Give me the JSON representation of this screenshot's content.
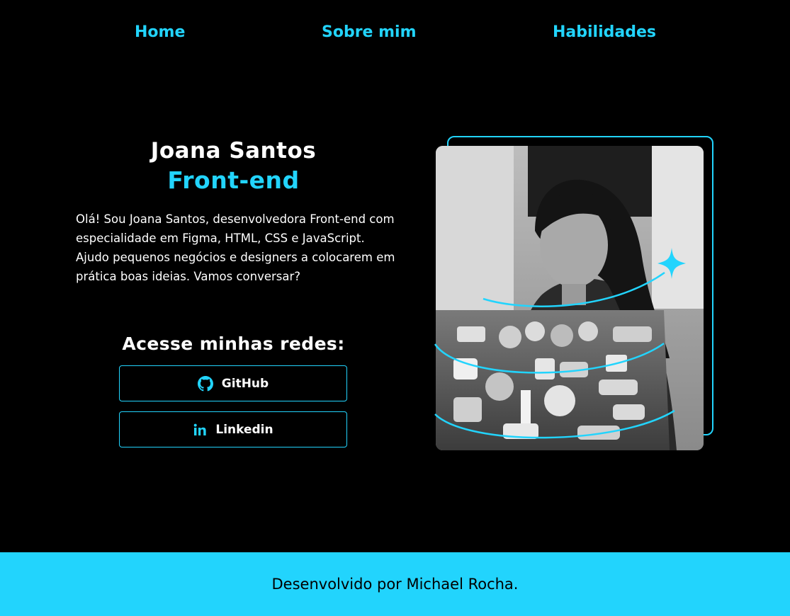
{
  "nav": {
    "items": [
      {
        "label": "Home"
      },
      {
        "label": "Sobre mim"
      },
      {
        "label": "Habilidades"
      }
    ]
  },
  "hero": {
    "name": "Joana Santos",
    "role": "Front-end",
    "bio": "Olá! Sou Joana Santos, desenvolvedora Front-end com especialidade em Figma, HTML, CSS e JavaScript. Ajudo pequenos negócios e designers a colocarem em prática boas ideias. Vamos conversar?",
    "social_title": "Acesse minhas redes:",
    "social": [
      {
        "label": "GitHub",
        "icon": "github-icon"
      },
      {
        "label": "Linkedin",
        "icon": "linkedin-icon"
      }
    ],
    "photo_alt": "Foto de Joana Santos"
  },
  "footer": {
    "text": "Desenvolvido por Michael Rocha."
  },
  "colors": {
    "accent": "#22d4fd",
    "background": "#000000",
    "text": "#ffffff"
  }
}
